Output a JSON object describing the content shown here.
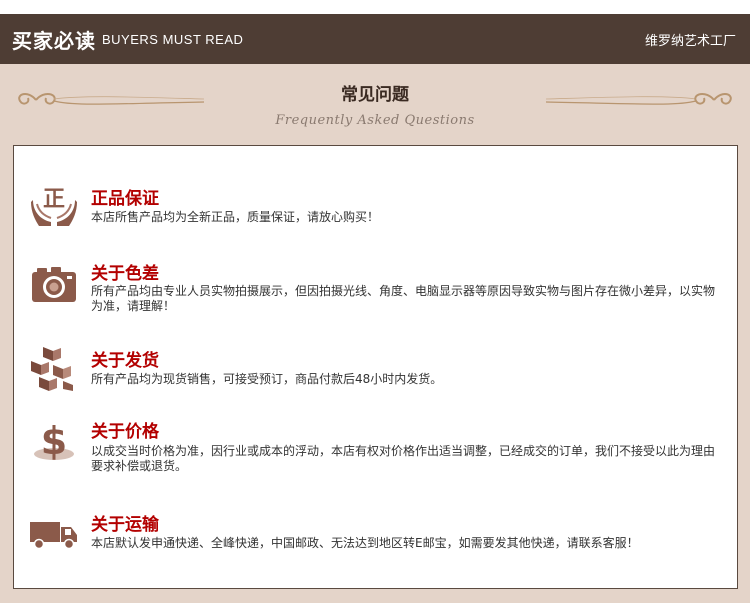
{
  "header": {
    "title_cn": "买家必读",
    "title_en": "BUYERS MUST READ",
    "shop_name": "维罗纳艺术工厂"
  },
  "faq": {
    "title": "常见问题",
    "subtitle": "Frequently Asked Questions",
    "items": [
      {
        "icon": "authentic-hands-icon",
        "title": "正品保证",
        "text": "本店所售产品均为全新正品，质量保证，请放心购买！"
      },
      {
        "icon": "camera-icon",
        "title": "关于色差",
        "text": "所有产品均由专业人员实物拍摄展示，但因拍摄光线、角度、电脑显示器等原因导致实物与图片存在微小差异，以实物为准，请理解！"
      },
      {
        "icon": "boxes-icon",
        "title": "关于发货",
        "text": "所有产品均为现货销售，可接受预订，商品付款后48小时内发货。"
      },
      {
        "icon": "dollar-icon",
        "title": "关于价格",
        "text": "以成交当时价格为准，因行业或成本的浮动，本店有权对价格作出适当调整，已经成交的订单，我们不接受以此为理由要求补偿或退货。"
      },
      {
        "icon": "truck-icon",
        "title": "关于运输",
        "text": "本店默认发申通快递、全峰快递，中国邮政、无法达到地区转E邮宝，如需要发其他快递，请联系客服！"
      }
    ]
  },
  "colors": {
    "header_bg": "#4e3d34",
    "beige_bg": "#e4d4c9",
    "question_red": "#b30000",
    "icon_brown": "#8b5a4a"
  }
}
